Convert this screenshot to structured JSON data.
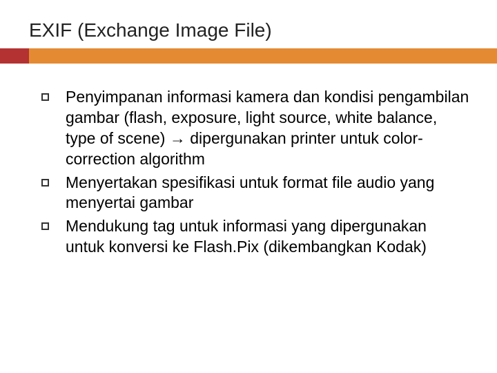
{
  "slide": {
    "title": "EXIF (Exchange Image File)",
    "bullets": [
      "Penyimpanan informasi kamera dan kondisi pengambilan gambar (flash, exposure, light source, white balance, type of scene) → dipergunakan printer untuk color-correction algorithm",
      "Menyertakan spesifikasi untuk format file audio yang menyertai gambar",
      "Mendukung tag untuk informasi yang dipergunakan untuk konversi ke Flash.Pix (dikembangkan Kodak)"
    ]
  },
  "colors": {
    "accent_bar_left": "#b43231",
    "accent_bar_right": "#e48a33"
  }
}
